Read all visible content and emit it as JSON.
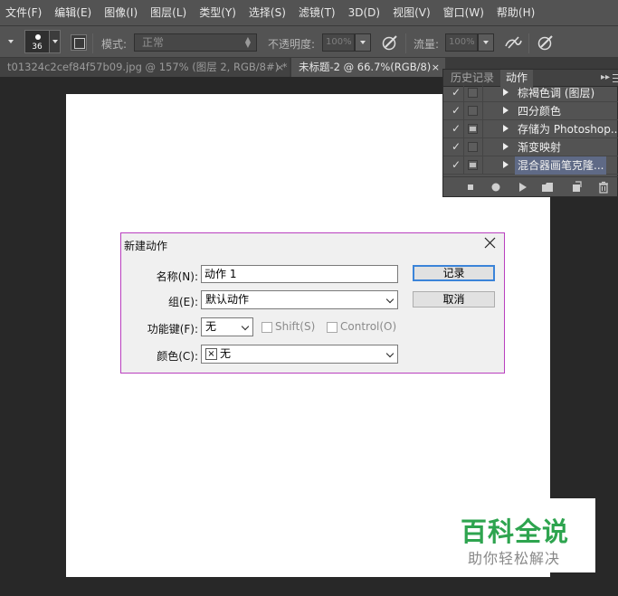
{
  "menubar": {
    "items": [
      "文件(F)",
      "编辑(E)",
      "图像(I)",
      "图层(L)",
      "类型(Y)",
      "选择(S)",
      "滤镜(T)",
      "3D(D)",
      "视图(V)",
      "窗口(W)",
      "帮助(H)"
    ]
  },
  "options": {
    "brush_size": "36",
    "mode_label": "模式:",
    "mode_value": "正常",
    "opacity_label": "不透明度:",
    "opacity_value": "100%",
    "flow_label": "流量:",
    "flow_value": "100%"
  },
  "tabs": [
    {
      "title": "t01324c2cef84f57b09.jpg @ 157% (图层 2, RGB/8#) *",
      "close": "×"
    },
    {
      "title": "未标题-2 @ 66.7%(RGB/8)",
      "close": "×"
    }
  ],
  "panel": {
    "tabs": [
      "历史记录",
      "动作"
    ],
    "arrows": "▸▸",
    "actions": [
      {
        "name": "棕褐色调 (图层)",
        "check": "✓"
      },
      {
        "name": "四分颜色",
        "check": "✓"
      },
      {
        "name": "存储为 Photoshop...",
        "check": "✓"
      },
      {
        "name": "渐变映射",
        "check": "✓"
      },
      {
        "name": "混合器画笔克隆...",
        "check": "✓"
      }
    ]
  },
  "dialog": {
    "title": "新建动作",
    "name_label": "名称(N):",
    "name_value": "动作 1",
    "group_label": "组(E):",
    "group_value": "默认动作",
    "fkey_label": "功能键(F):",
    "fkey_value": "无",
    "shift_label": "Shift(S)",
    "control_label": "Control(O)",
    "color_label": "颜色(C):",
    "color_x": "×",
    "color_value": "无",
    "record_button": "记录",
    "cancel_button": "取消"
  },
  "watermark": {
    "title": "百科全说",
    "subtitle": "助你轻松解决"
  }
}
